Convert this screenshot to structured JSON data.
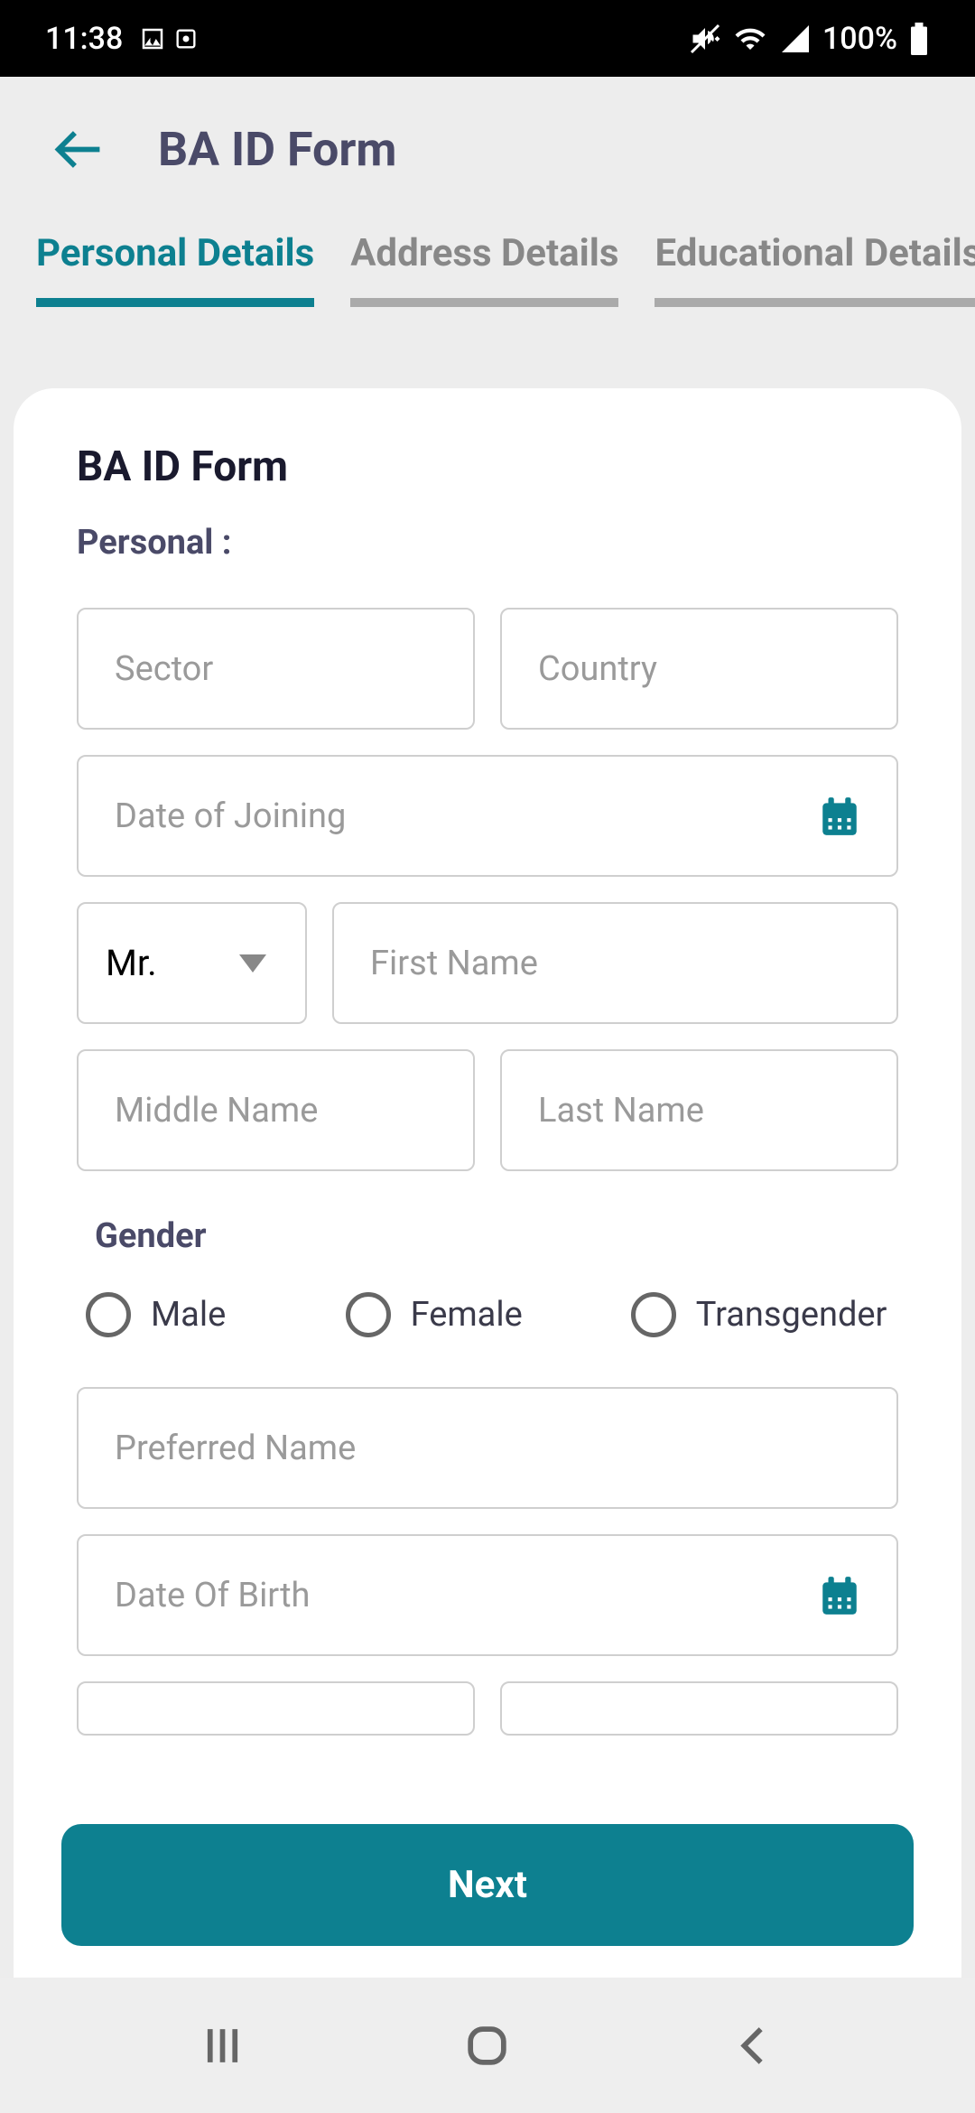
{
  "status": {
    "time": "11:38",
    "battery": "100%"
  },
  "header": {
    "title": "BA ID Form"
  },
  "tabs": [
    {
      "label": "Personal Details",
      "active": true
    },
    {
      "label": "Address Details",
      "active": false
    },
    {
      "label": "Educational Details",
      "active": false
    }
  ],
  "form": {
    "title": "BA ID Form",
    "section": "Personal :",
    "sector_placeholder": "Sector",
    "country_placeholder": "Country",
    "doj_placeholder": "Date of Joining",
    "title_select": "Mr.",
    "first_name_placeholder": "First Name",
    "middle_name_placeholder": "Middle Name",
    "last_name_placeholder": "Last Name",
    "gender_label": "Gender",
    "gender_options": {
      "male": "Male",
      "female": "Female",
      "transgender": "Transgender"
    },
    "preferred_name_placeholder": "Preferred Name",
    "dob_placeholder": "Date Of Birth",
    "next_button": "Next"
  }
}
